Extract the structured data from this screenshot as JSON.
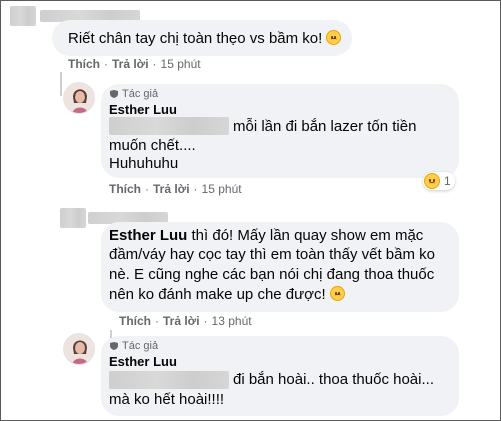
{
  "colors": {
    "bubble": "#f0f2f5",
    "meta": "#65676b",
    "text": "#050505"
  },
  "comments": [
    {
      "text": "Riết chân tay chị toàn thẹo vs bầm ko!",
      "emoji": "sad-face-icon",
      "actions": {
        "like": "Thích",
        "reply": "Trả lời",
        "sep": "·",
        "time": "15 phút"
      }
    },
    {
      "badge": "Tác giả",
      "name": "Esther Luu",
      "lines": [
        "mỗi lần đi bắn lazer tốn tiền",
        "muốn chết....",
        "Huhuhuhu"
      ],
      "actions": {
        "like": "Thích",
        "reply": "Trả lời",
        "sep": "·",
        "time": "15 phút"
      },
      "reaction_count": "1"
    },
    {
      "name": "Esther Luu",
      "name_suffix": "thì đó! Mấy lần quay show em mặc",
      "lines": [
        "đầm/váy hay cọc tay thì em toàn thấy vết bầm ko",
        "nè. E cũng nghe các bạn nói chị đang thoa thuốc",
        "nên ko đánh make up che được!"
      ],
      "actions": {
        "like": "Thích",
        "reply": "Trả lời",
        "sep": "·",
        "time": "13 phút"
      }
    },
    {
      "badge": "Tác giả",
      "name": "Esther Luu",
      "lines": [
        "đi bắn hoài.. thoa thuốc hoài...",
        "mà ko hết hoài!!!!"
      ]
    }
  ]
}
